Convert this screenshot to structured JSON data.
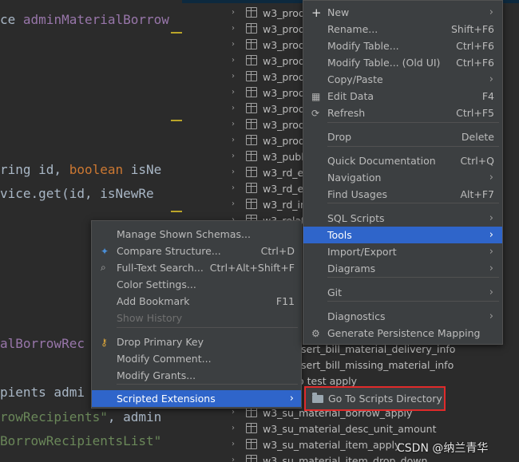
{
  "editor": {
    "lines": [
      {
        "pre": "ce ",
        "id": "adminMaterialBorrow"
      },
      {
        "pre": "ring id, ",
        "kw": "boolean",
        "post": " isNe"
      },
      {
        "pre": "vice.get(id, isNewRe"
      },
      {
        "pre": "alBorrowRec"
      },
      {
        "pre": "pients admi"
      },
      {
        "str": "rowRecipients\"",
        "post": ", admin"
      },
      {
        "str": "BorrowRecipientsList\""
      }
    ]
  },
  "tree": {
    "items": [
      "w3_prod",
      "w3_prod",
      "w3_prod",
      "w3_prod",
      "w3_prod",
      "w3_prod",
      "w3_prod",
      "w3_prod",
      "w3_prod",
      "w3_publ",
      "w3_rd_er",
      "w3_rd_er",
      "w3_rd_in",
      "w3_relat"
    ],
    "lower_items": [
      "sert_bill_material_delivery_info",
      "sert_bill_missing_material_info",
      "o test apply",
      "w3_su_material_borrow_apply",
      "w3_su_material_desc_unit_amount",
      "w3_su_material_item_apply",
      "w3_su_material_item_drop_down"
    ]
  },
  "context_menu": {
    "items": [
      {
        "label": "New",
        "icon": "plus-icon",
        "submenu": true
      },
      {
        "label": "Rename...",
        "shortcut": "Shift+F6"
      },
      {
        "label": "Modify Table...",
        "shortcut": "Ctrl+F6"
      },
      {
        "label": "Modify Table... (Old UI)",
        "shortcut": "Ctrl+F6"
      },
      {
        "label": "Copy/Paste",
        "submenu": true
      },
      {
        "label": "Edit Data",
        "icon": "table-icon",
        "shortcut": "F4"
      },
      {
        "label": "Refresh",
        "icon": "refresh-icon",
        "shortcut": "Ctrl+F5"
      },
      {
        "label": "Drop",
        "shortcut": "Delete"
      },
      {
        "label": "Quick Documentation",
        "shortcut": "Ctrl+Q"
      },
      {
        "label": "Navigation",
        "submenu": true
      },
      {
        "label": "Find Usages",
        "shortcut": "Alt+F7"
      },
      {
        "label": "SQL Scripts",
        "submenu": true
      },
      {
        "label": "Tools",
        "submenu": true,
        "selected": true
      },
      {
        "label": "Import/Export",
        "submenu": true
      },
      {
        "label": "Diagrams",
        "submenu": true
      },
      {
        "label": "Git",
        "submenu": true
      },
      {
        "label": "Diagnostics",
        "submenu": true
      },
      {
        "label": "Generate Persistence Mapping",
        "icon": "persistence-icon"
      }
    ]
  },
  "tools_menu": {
    "items": [
      {
        "label": "Manage Shown Schemas..."
      },
      {
        "label": "Compare Structure...",
        "icon": "compare-icon",
        "shortcut": "Ctrl+D"
      },
      {
        "label": "Full-Text Search...",
        "icon": "search-icon",
        "shortcut": "Ctrl+Alt+Shift+F"
      },
      {
        "label": "Color Settings..."
      },
      {
        "label": "Add Bookmark",
        "shortcut": "F11"
      },
      {
        "label": "Show History",
        "disabled": true
      },
      {
        "label": "Drop Primary Key",
        "icon": "key-icon"
      },
      {
        "label": "Modify Comment..."
      },
      {
        "label": "Modify Grants..."
      },
      {
        "label": "Scripted Extensions",
        "submenu": true,
        "selected": true
      }
    ]
  },
  "scripted_submenu": {
    "label": "Go To Scripts Directory",
    "icon": "folder-icon",
    "highlight_color": "#e02a2a"
  },
  "watermark": "CSDN @纳兰青华",
  "colors": {
    "selection": "#2f65ca",
    "menu_bg": "#3c3f41",
    "editor_bg": "#2b2b2b"
  }
}
